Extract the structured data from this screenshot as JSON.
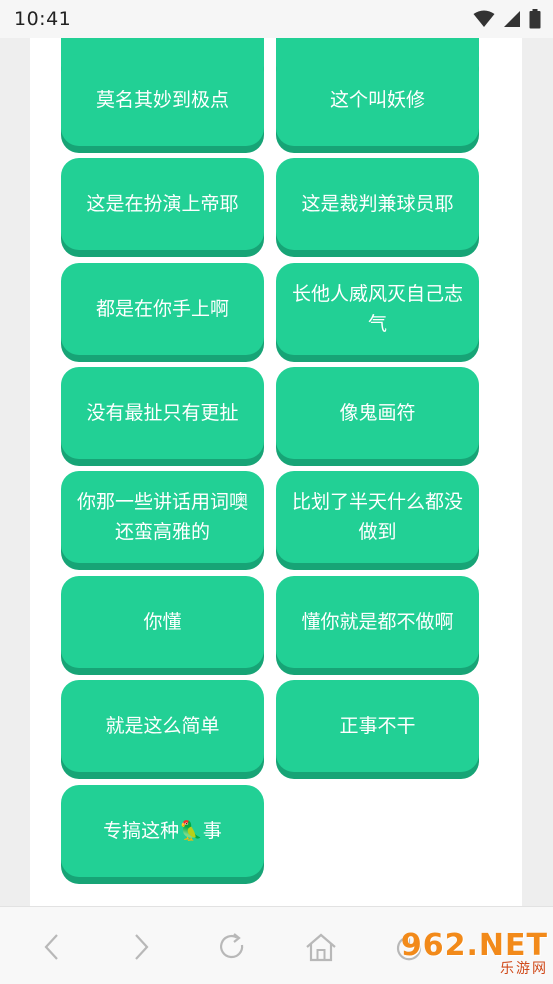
{
  "status_bar": {
    "time": "10:41"
  },
  "buttons": [
    {
      "label": ""
    },
    {
      "label": ""
    },
    {
      "label": "莫名其妙到极点"
    },
    {
      "label": "这个叫妖修"
    },
    {
      "label": "这是在扮演上帝耶"
    },
    {
      "label": "这是裁判兼球员耶"
    },
    {
      "label": "都是在你手上啊"
    },
    {
      "label": "长他人威风灭自己志气"
    },
    {
      "label": "没有最扯只有更扯"
    },
    {
      "label": "像鬼画符"
    },
    {
      "label": "你那一些讲话用词噢还蛮高雅的"
    },
    {
      "label": "比划了半天什么都没做到"
    },
    {
      "label": "你懂"
    },
    {
      "label": "懂你就是都不做啊"
    },
    {
      "label": "就是这么简单"
    },
    {
      "label": "正事不干"
    },
    {
      "label": "专搞这种🦜事"
    }
  ],
  "colors": {
    "button": "#22d095",
    "button_shadow": "#17a476"
  },
  "bottom_nav": {
    "items": [
      {
        "icon": "back-arrow-icon"
      },
      {
        "icon": "forward-arrow-icon"
      },
      {
        "icon": "refresh-icon"
      },
      {
        "icon": "home-icon"
      },
      {
        "icon": "power-icon"
      }
    ]
  },
  "watermark": {
    "top": "962.NET",
    "bottom": "乐游网"
  }
}
